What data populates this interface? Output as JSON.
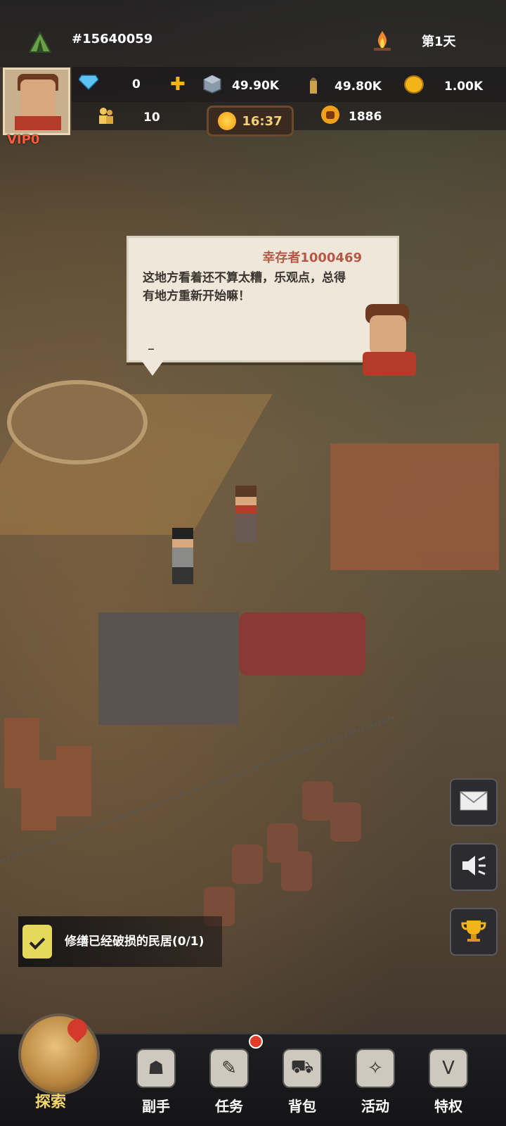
{
  "header": {
    "player_id": "#15640059",
    "day_label": "第1天"
  },
  "resources": {
    "diamonds": "0",
    "stone": "49.90K",
    "ammo": "49.80K",
    "gold": "1.00K",
    "population": "10",
    "power": "1886",
    "time": "16:37"
  },
  "player": {
    "vip": "VIP0"
  },
  "dialog": {
    "speaker": "幸存者1000469",
    "message": "这地方看着还不算太糟，乐观点，总得有地方重新开始嘛！",
    "cursor": "_"
  },
  "task": {
    "text": "修缮已经破损的民居(0/1)"
  },
  "side_buttons": {
    "mail_icon": "envelope",
    "sound_icon": "speaker",
    "trophy_icon": "trophy"
  },
  "nav": {
    "explore": "探索",
    "assistant": "副手",
    "tasks": "任务",
    "bag": "背包",
    "events": "活动",
    "privileges": "特权"
  },
  "colors": {
    "accent_gold": "#f3d66b",
    "speaker_red": "#b55848",
    "badge_red": "#e33a2a"
  }
}
